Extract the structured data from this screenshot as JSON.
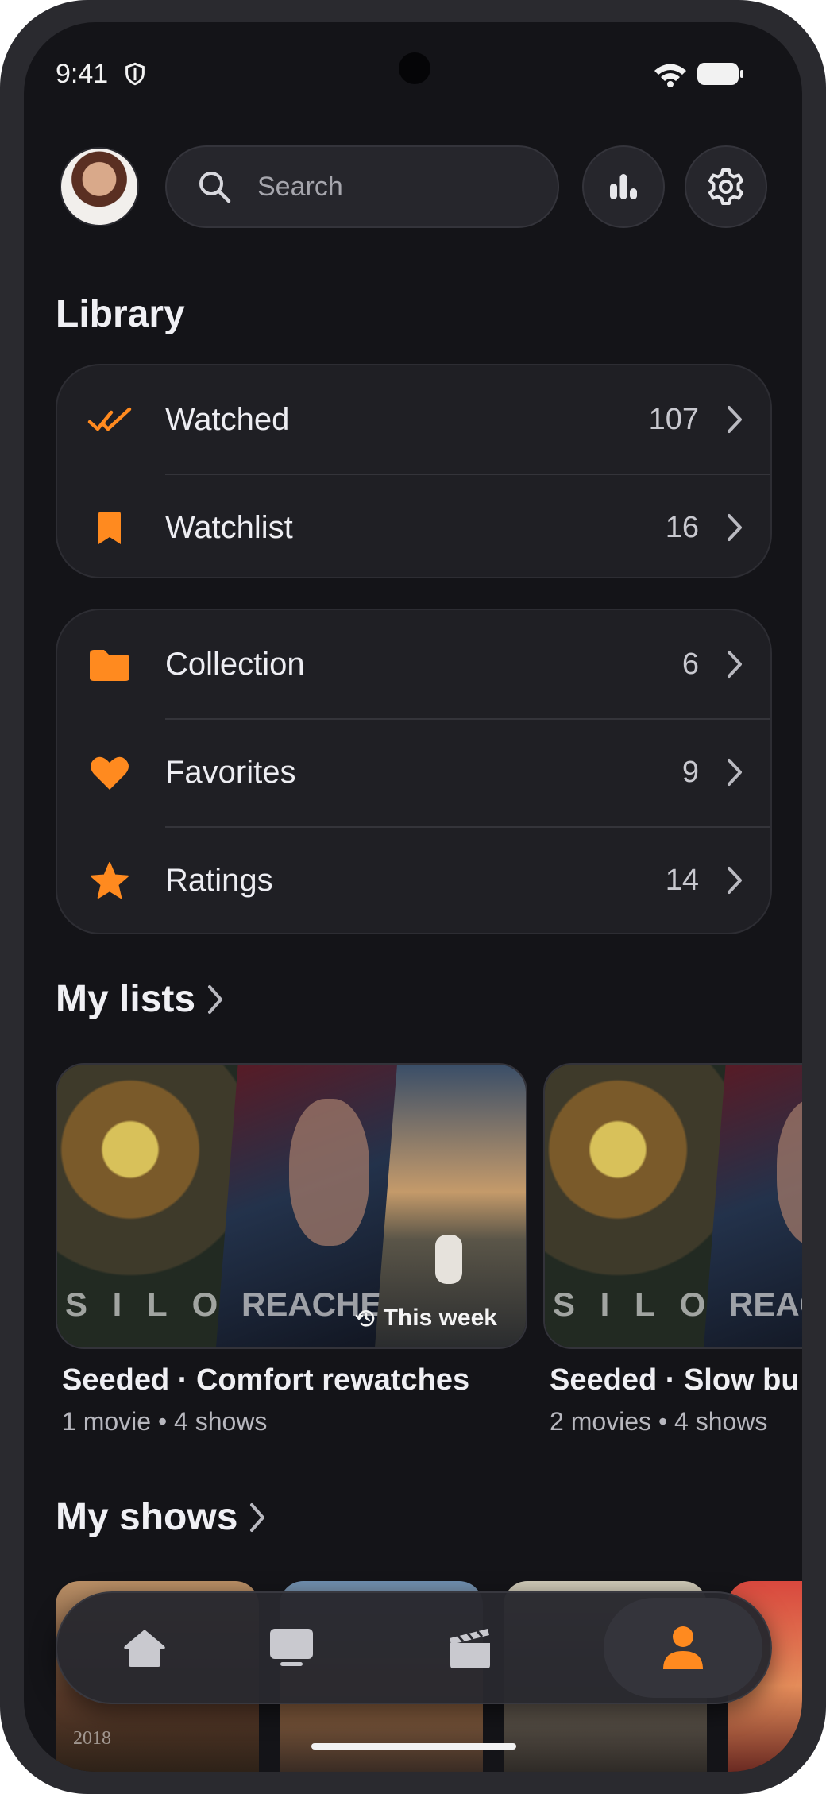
{
  "status_bar": {
    "time": "9:41"
  },
  "header": {
    "search_placeholder": "Search"
  },
  "library": {
    "title": "Library",
    "group1": [
      {
        "label": "Watched",
        "count": "107",
        "icon": "double-check-icon"
      },
      {
        "label": "Watchlist",
        "count": "16",
        "icon": "bookmark-icon"
      }
    ],
    "group2": [
      {
        "label": "Collection",
        "count": "6",
        "icon": "folder-icon"
      },
      {
        "label": "Favorites",
        "count": "9",
        "icon": "heart-icon"
      },
      {
        "label": "Ratings",
        "count": "14",
        "icon": "star-icon"
      }
    ]
  },
  "my_lists": {
    "title": "My lists",
    "items": [
      {
        "title": "Seeded · Comfort rewatches",
        "subtitle": "1 movie • 4 shows",
        "badge": "This week",
        "poster1_text": "S I L O",
        "poster2_text": "REACHER"
      },
      {
        "title": "Seeded · Slow bu",
        "subtitle": "2 movies • 4 shows",
        "poster1_text": "S I L O",
        "poster2_text": "REACH"
      }
    ]
  },
  "my_shows": {
    "title": "My shows",
    "poster1_text": "2018"
  },
  "nav": {
    "items": [
      "home",
      "tv",
      "movies",
      "profile"
    ],
    "active": "profile"
  },
  "colors": {
    "accent": "#ff8a1f",
    "background": "#141418",
    "card": "#1f1f24"
  }
}
